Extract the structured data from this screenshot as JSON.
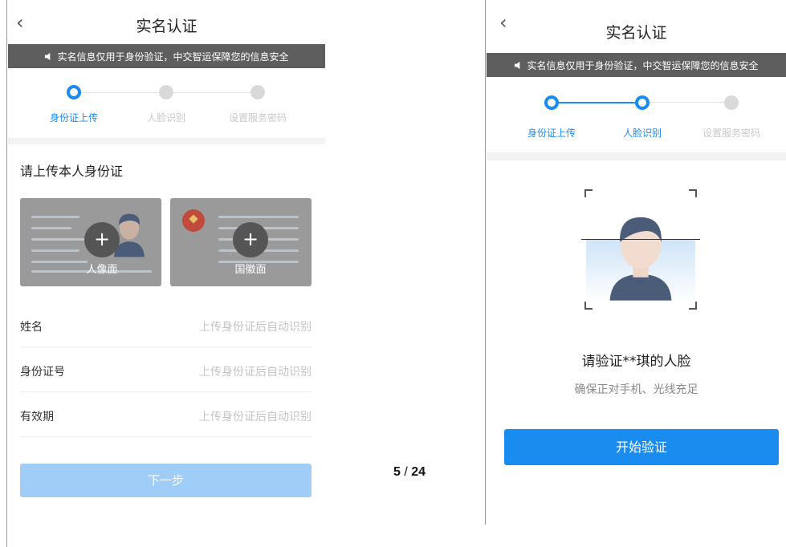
{
  "left_screen": {
    "title": "实名认证",
    "back_icon": "chevron-left-icon",
    "notice": "实名信息仅用于身份验证，中交智运保障您的信息安全",
    "steps": [
      {
        "label": "身份证上传",
        "state": "active"
      },
      {
        "label": "人脸识别",
        "state": "inactive"
      },
      {
        "label": "设置服务密码",
        "state": "inactive"
      }
    ],
    "section_title": "请上传本人身份证",
    "upload_cards": [
      {
        "label": "人像面",
        "plus": "+"
      },
      {
        "label": "国徽面",
        "plus": "+"
      }
    ],
    "fields": [
      {
        "label": "姓名",
        "placeholder": "上传身份证后自动识别"
      },
      {
        "label": "身份证号",
        "placeholder": "上传身份证后自动识别"
      },
      {
        "label": "有效期",
        "placeholder": "上传身份证后自动识别"
      }
    ],
    "next_button": "下一步"
  },
  "page_indicator": {
    "current": "5",
    "separator": "/",
    "total": "24"
  },
  "right_screen": {
    "title": "实名认证",
    "back_icon": "chevron-left-icon",
    "notice": "实名信息仅用于身份验证，中交智运保障您的信息安全",
    "steps": [
      {
        "label": "身份证上传",
        "state": "done"
      },
      {
        "label": "人脸识别",
        "state": "active"
      },
      {
        "label": "设置服务密码",
        "state": "inactive"
      }
    ],
    "verify_title": "请验证**琪的人脸",
    "verify_hint": "确保正对手机、光线充足",
    "start_button": "开始验证"
  },
  "colors": {
    "accent": "#1a8cf0",
    "next_button_disabled": "#9fcdf7",
    "notice_bg": "#5e5e5e"
  }
}
